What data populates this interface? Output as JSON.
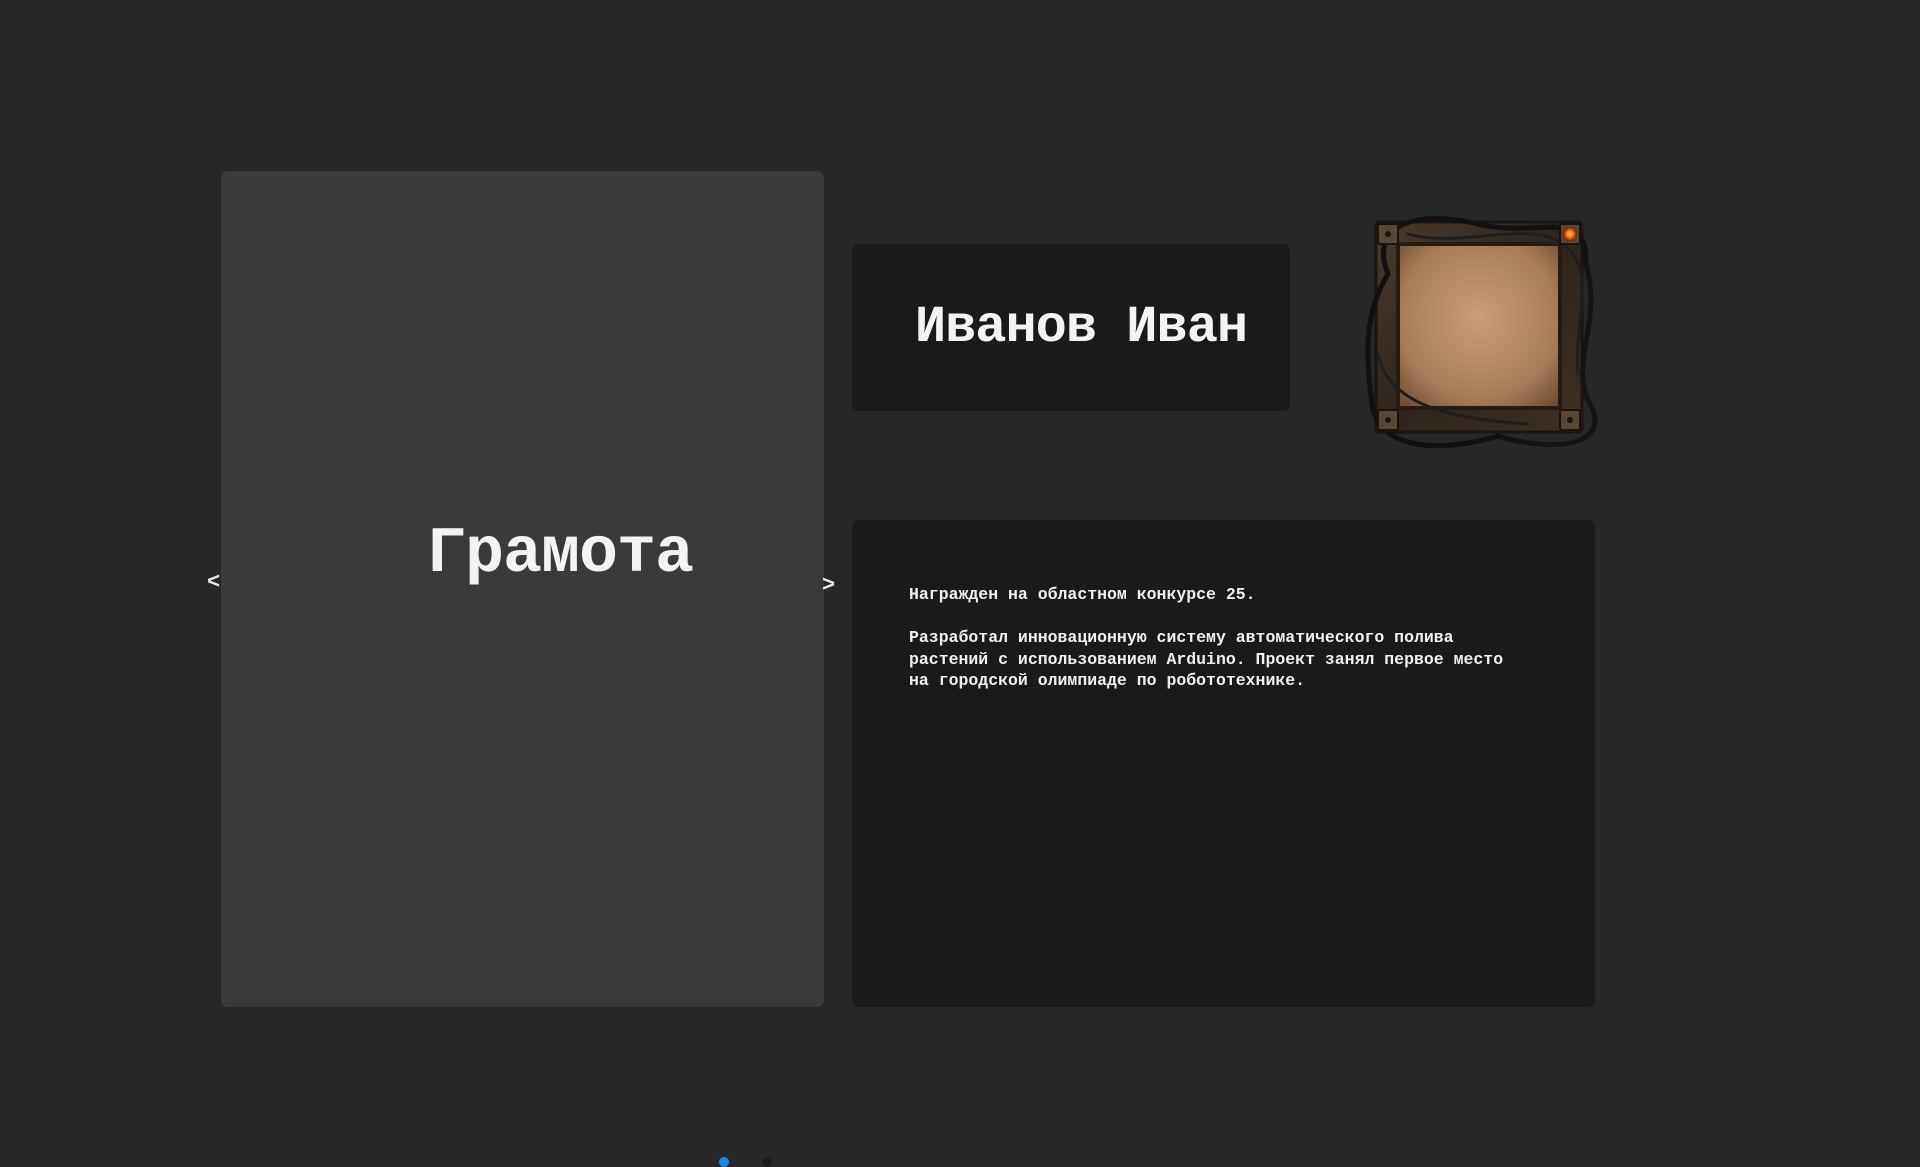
{
  "slider": {
    "title": "Грамота",
    "prev_label": "<",
    "next_label": ">",
    "dots": [
      {
        "active": true
      },
      {
        "active": false
      }
    ]
  },
  "profile": {
    "name": "Иванов Иван",
    "avatar_icon": "picture-frame-icon"
  },
  "description": {
    "text": "Награжден на областном конкурсе 25.\n\nРазработал инновационную систему автоматического полива\nрастений с использованием Arduino. Проект занял первое место\nна городской олимпиаде по робототехнике."
  },
  "colors": {
    "background": "#272727",
    "slider_card": "#3a393b",
    "panel": "#1a1a1a",
    "text": "#f3f3f3",
    "dot_active": "#1e88e5",
    "dot_inactive": "#1b1b1b"
  }
}
